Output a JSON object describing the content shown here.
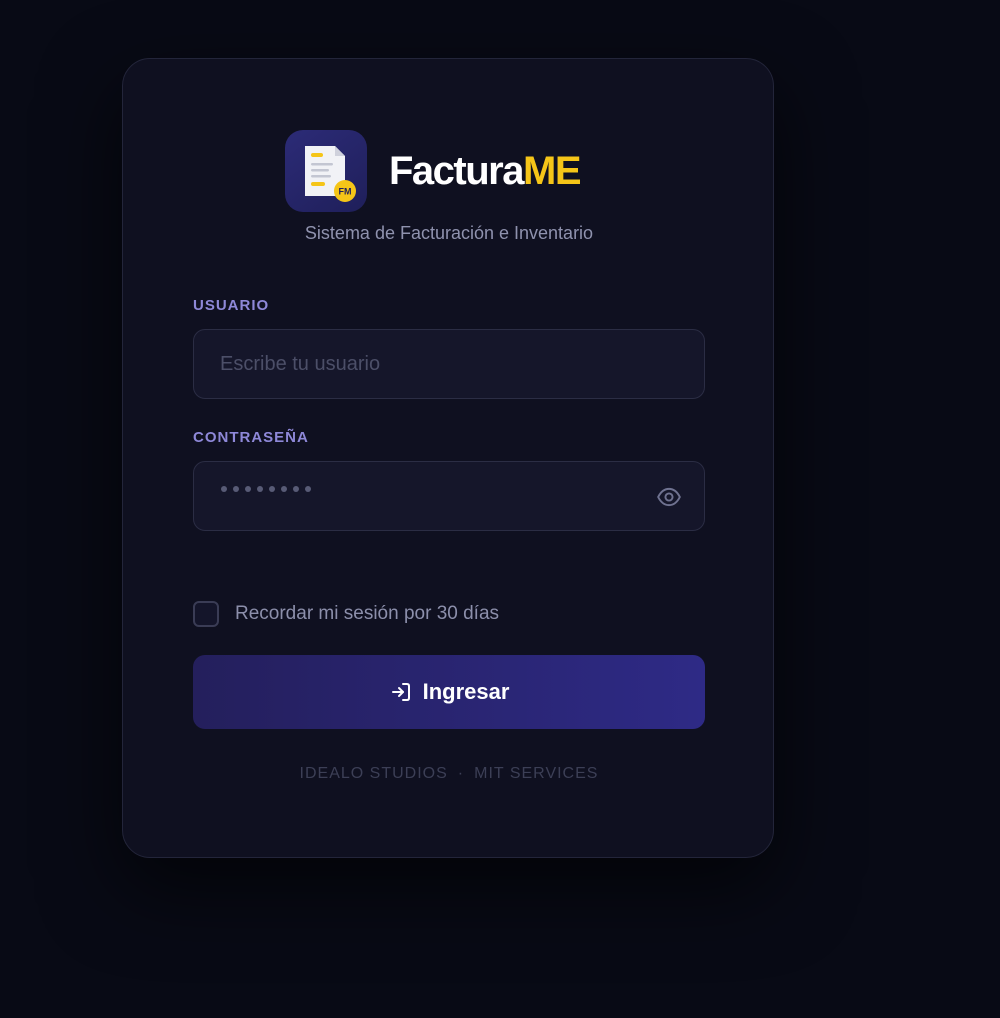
{
  "brand": {
    "name_main": "Factura",
    "name_accent": "ME",
    "logo_badge": "FM",
    "subtitle": "Sistema de Facturación e Inventario"
  },
  "form": {
    "username": {
      "label": "USUARIO",
      "placeholder": "Escribe tu usuario",
      "value": ""
    },
    "password": {
      "label": "CONTRASEÑA",
      "masked_length": 8
    },
    "remember": {
      "label": "Recordar mi sesión por 30 días",
      "checked": false
    },
    "submit_label": "Ingresar"
  },
  "footer": {
    "left": "IDEALO STUDIOS",
    "separator": "·",
    "right": "MIT SERVICES"
  },
  "colors": {
    "background": "#080a15",
    "card": "#0f1020",
    "accent_yellow": "#f5c518",
    "label_purple": "#8e88d8",
    "button": "#2e2a86"
  },
  "icons": {
    "logo": "invoice-document-icon",
    "password_toggle": "eye-icon",
    "submit": "login-arrow-icon"
  }
}
